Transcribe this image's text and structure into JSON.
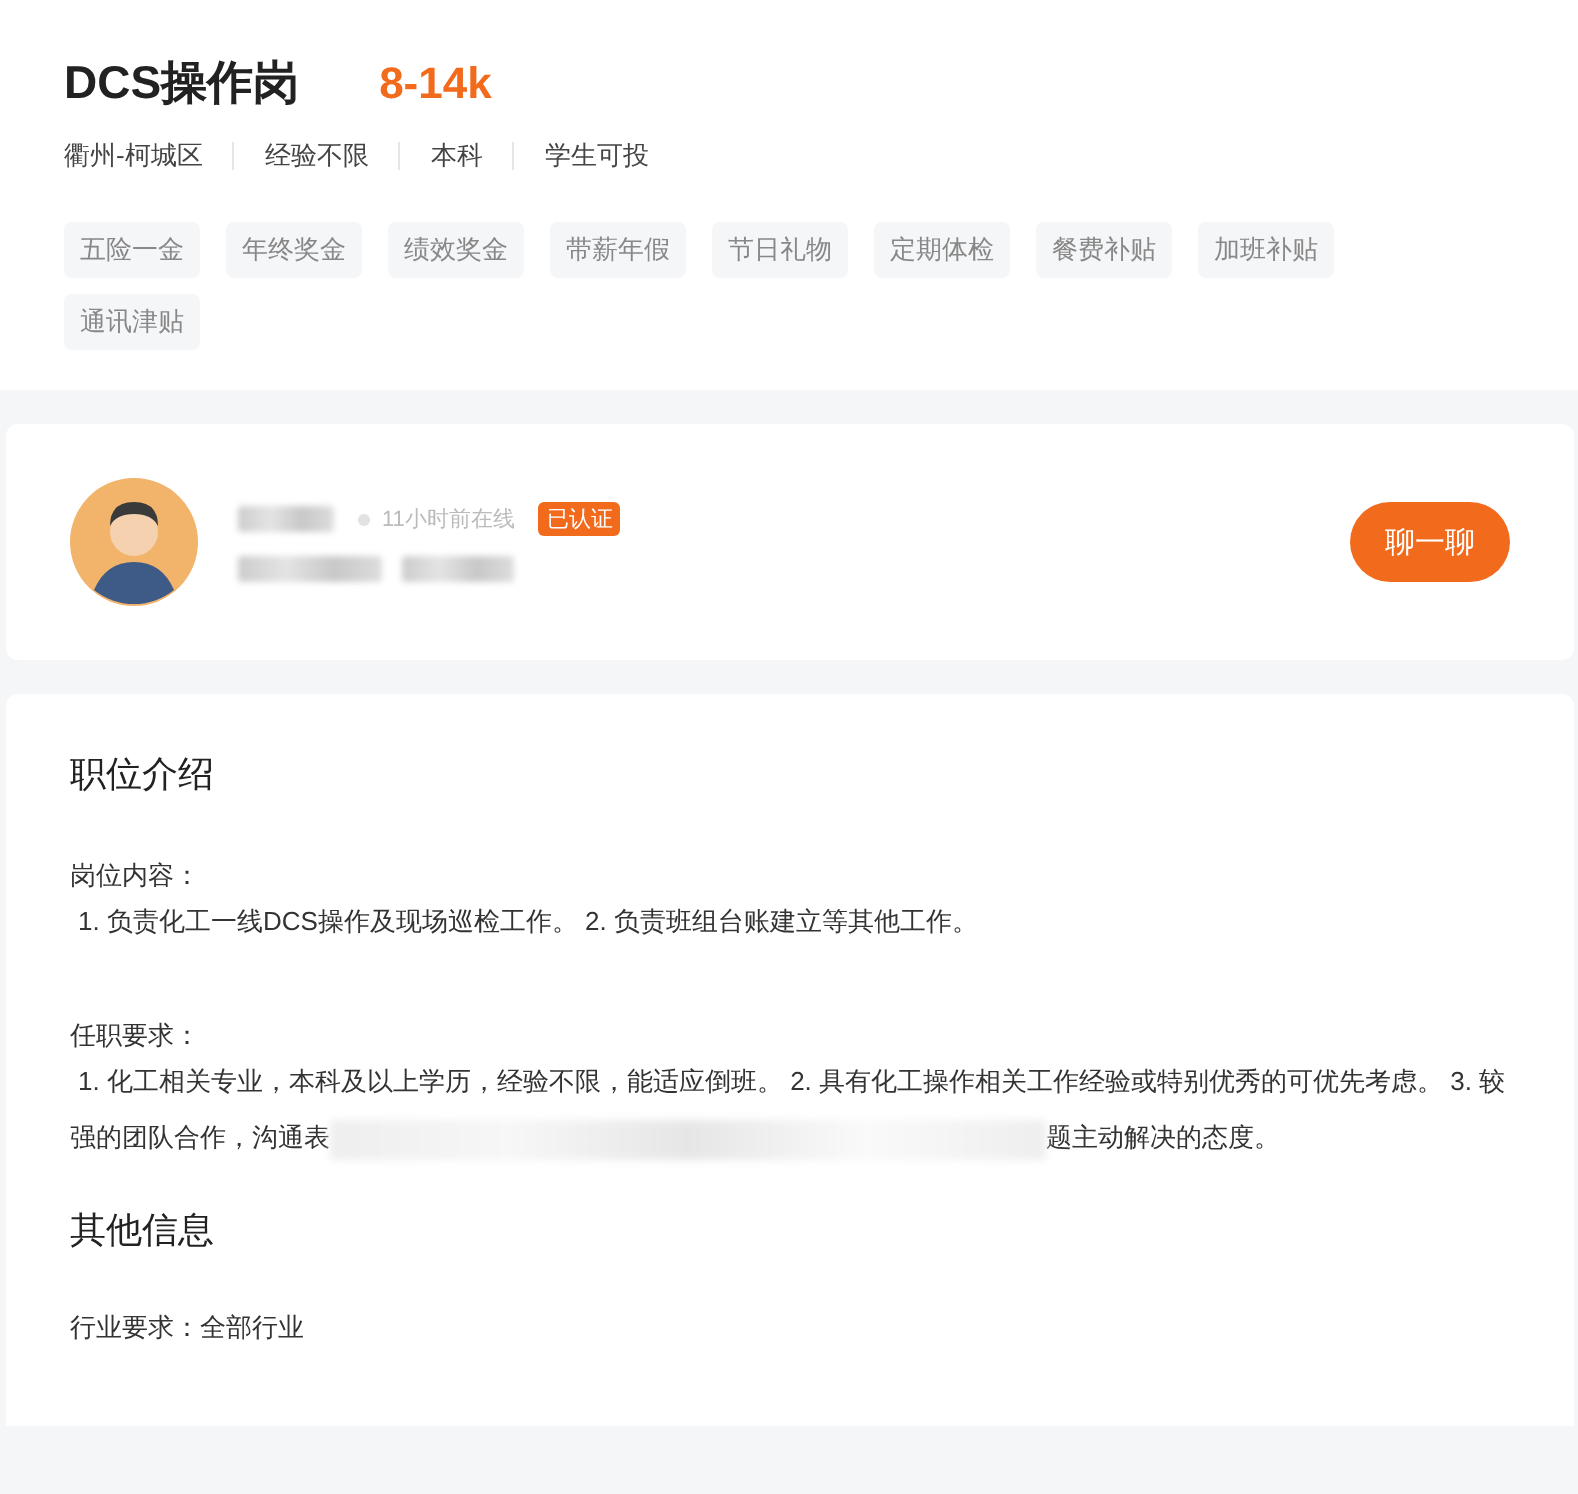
{
  "job": {
    "title": "DCS操作岗",
    "salary": "8-14k",
    "meta": [
      "衢州-柯城区",
      "经验不限",
      "本科",
      "学生可投"
    ],
    "benefits": [
      "五险一金",
      "年终奖金",
      "绩效奖金",
      "带薪年假",
      "节日礼物",
      "定期体检",
      "餐费补贴",
      "加班补贴",
      "通讯津贴"
    ]
  },
  "recruiter": {
    "online": "11小时前在线",
    "badge": "已认证",
    "chat_button": "聊一聊"
  },
  "description": {
    "heading": "职位介绍",
    "duties": {
      "label": "岗位内容：",
      "text": "1. 负责化工一线DCS操作及现场巡检工作。 2. 负责班组台账建立等其他工作。"
    },
    "requirements": {
      "label": "任职要求：",
      "text_before_redaction": "1. 化工相关专业，本科及以上学历，经验不限，能适应倒班。 2. 具有化工操作相关工作经验或特别优秀的可优先考虑。 3. 较强的团队合作，沟通表",
      "text_after_redaction": "题主动解决的态度。"
    }
  },
  "other": {
    "heading": "其他信息",
    "industry": "行业要求：全部行业"
  }
}
